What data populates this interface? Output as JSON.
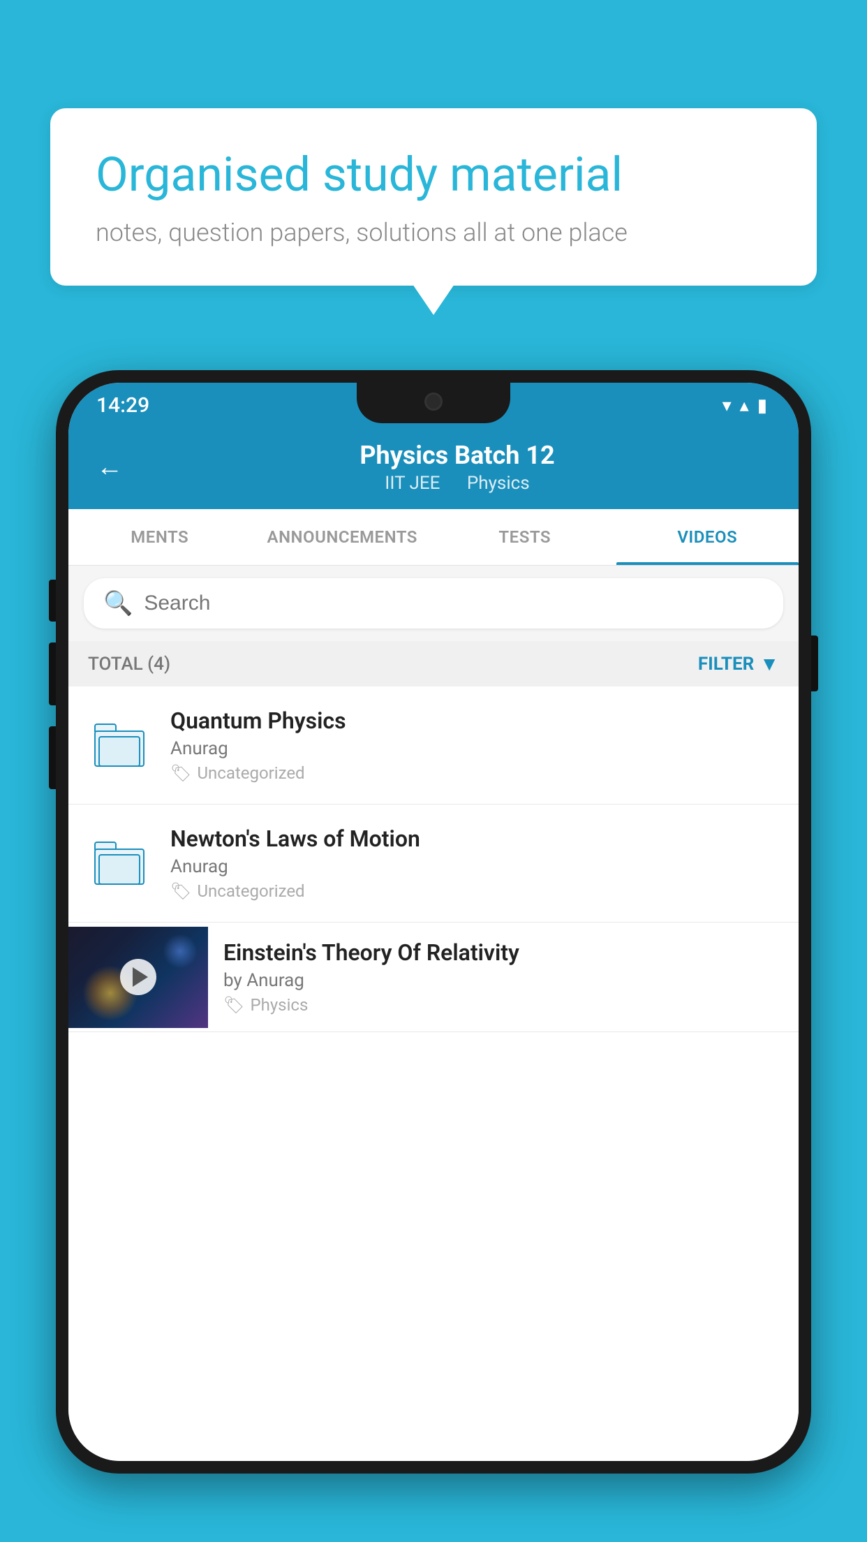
{
  "background_color": "#29b6d8",
  "speech_bubble": {
    "title": "Organised study material",
    "subtitle": "notes, question papers, solutions all at one place"
  },
  "status_bar": {
    "time": "14:29",
    "wifi_icon": "▼",
    "signal_icon": "▲",
    "battery_icon": "▮"
  },
  "header": {
    "title": "Physics Batch 12",
    "tag1": "IIT JEE",
    "tag2": "Physics",
    "back_label": "←"
  },
  "tabs": [
    {
      "label": "MENTS",
      "active": false
    },
    {
      "label": "ANNOUNCEMENTS",
      "active": false
    },
    {
      "label": "TESTS",
      "active": false
    },
    {
      "label": "VIDEOS",
      "active": true
    }
  ],
  "search": {
    "placeholder": "Search"
  },
  "filter_row": {
    "total_label": "TOTAL (4)",
    "filter_label": "FILTER"
  },
  "list_items": [
    {
      "type": "folder",
      "title": "Quantum Physics",
      "author": "Anurag",
      "tag": "Uncategorized"
    },
    {
      "type": "folder",
      "title": "Newton's Laws of Motion",
      "author": "Anurag",
      "tag": "Uncategorized"
    },
    {
      "type": "video",
      "title": "Einstein's Theory Of Relativity",
      "author": "by Anurag",
      "tag": "Physics"
    }
  ]
}
